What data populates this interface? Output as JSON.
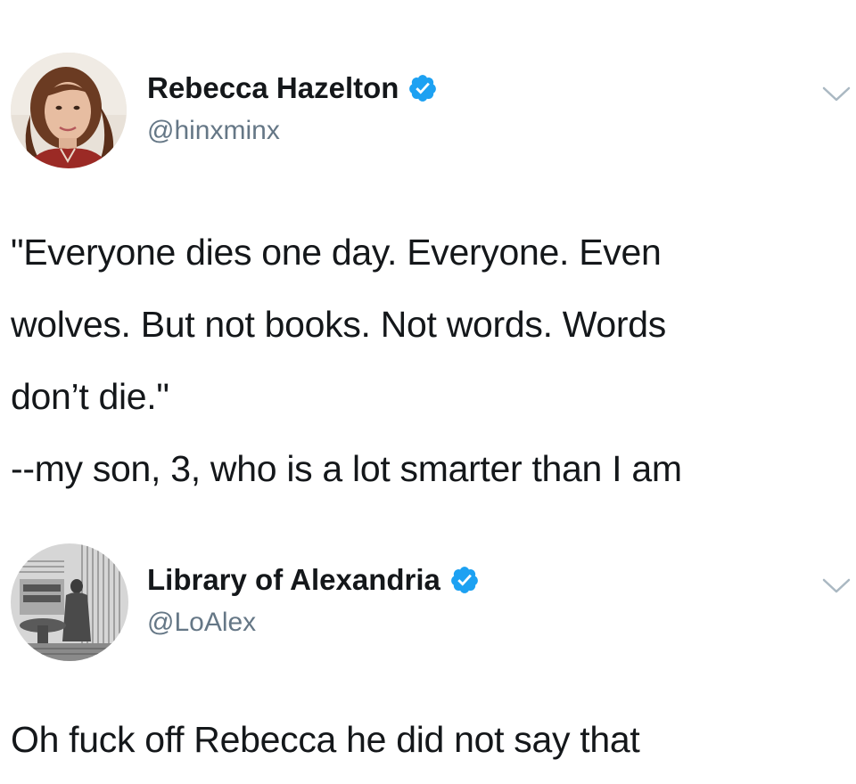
{
  "tweets": [
    {
      "display_name": "Rebecca Hazelton",
      "handle": "@hinxminx",
      "verified": true,
      "avatar_icon": "portrait-photo",
      "menu_icon": "chevron-down-icon",
      "lines": [
        "\"Everyone dies one day. Everyone. Even",
        "wolves. But not books. Not words. Words",
        "don’t die.\"",
        "--my son, 3, who is a lot smarter than I am"
      ]
    },
    {
      "display_name": "Library of Alexandria",
      "handle": "@LoAlex",
      "verified": true,
      "avatar_icon": "engraving-scholar-photo",
      "menu_icon": "chevron-down-icon",
      "lines": [
        "Oh fuck off Rebecca he did not say that"
      ]
    }
  ],
  "colors": {
    "text": "#14171a",
    "secondary": "#657786",
    "verified": "#1da1f2",
    "background": "#ffffff"
  }
}
